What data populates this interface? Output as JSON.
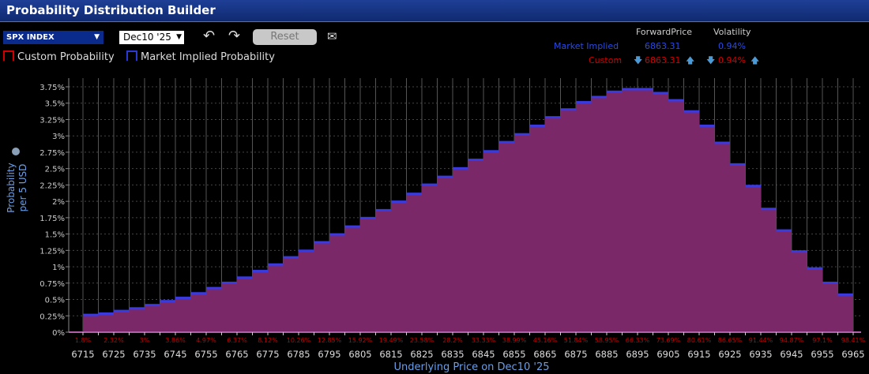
{
  "window": {
    "title": "Probability Distribution Builder"
  },
  "toolbar": {
    "ticker": "SPX INDEX",
    "expiry": "Dec10 '25",
    "reset_label": "Reset",
    "icons": [
      "undo-icon",
      "redo-icon",
      "mail-icon"
    ]
  },
  "legend": {
    "custom": "Custom Probability",
    "market": "Market Implied Probability"
  },
  "stats": {
    "headers": {
      "forward": "ForwardPrice",
      "vol": "Volatility"
    },
    "market": {
      "label": "Market Implied",
      "forward": "6863.31",
      "vol": "0.94%"
    },
    "custom": {
      "label": "Custom",
      "forward": "6863.31",
      "vol": "0.94%"
    }
  },
  "colors": {
    "bar": "#7a2868",
    "bar_top": "#3a3ae0",
    "custom": "#d00000",
    "market": "#2a3ad0",
    "cum_label": "#c00000"
  },
  "chart_data": {
    "type": "bar",
    "ylabel": "Probability per 5 USD",
    "xlabel": "Underlying Price on Dec10 '25",
    "ylim": [
      0,
      3.75
    ],
    "y_ticks": [
      "0%",
      "0.25%",
      "0.5%",
      "0.75%",
      "1%",
      "1.25%",
      "1.5%",
      "1.75%",
      "2%",
      "2.25%",
      "2.5%",
      "2.75%",
      "3%",
      "3.25%",
      "3.5%",
      "3.75%"
    ],
    "x_start": 6715,
    "bin_width": 5,
    "x_tick_labels": [
      "6715",
      "6725",
      "6735",
      "6745",
      "6755",
      "6765",
      "6775",
      "6785",
      "6795",
      "6805",
      "6815",
      "6825",
      "6835",
      "6845",
      "6855",
      "6865",
      "6875",
      "6885",
      "6895",
      "6905",
      "6915",
      "6925",
      "6935",
      "6945",
      "6955",
      "6965"
    ],
    "cumulative_labels": [
      "1.8%",
      "2.32%",
      "3%",
      "3.86%",
      "4.97%",
      "6.37%",
      "8.12%",
      "10.26%",
      "12.85%",
      "15.92%",
      "19.49%",
      "23.58%",
      "28.2%",
      "33.33%",
      "38.99%",
      "45.16%",
      "51.84%",
      "58.95%",
      "66.33%",
      "73.69%",
      "80.61%",
      "86.65%",
      "91.44%",
      "94.87%",
      "97.1%",
      "98.41%"
    ],
    "values": [
      0.27,
      0.29,
      0.33,
      0.37,
      0.42,
      0.48,
      0.53,
      0.6,
      0.68,
      0.76,
      0.84,
      0.94,
      1.04,
      1.15,
      1.25,
      1.38,
      1.5,
      1.62,
      1.75,
      1.87,
      2.0,
      2.12,
      2.26,
      2.38,
      2.51,
      2.64,
      2.77,
      2.91,
      3.03,
      3.16,
      3.29,
      3.41,
      3.52,
      3.6,
      3.68,
      3.72,
      3.72,
      3.66,
      3.55,
      3.38,
      3.16,
      2.9,
      2.57,
      2.24,
      1.89,
      1.56,
      1.24,
      0.98,
      0.76,
      0.58
    ]
  }
}
